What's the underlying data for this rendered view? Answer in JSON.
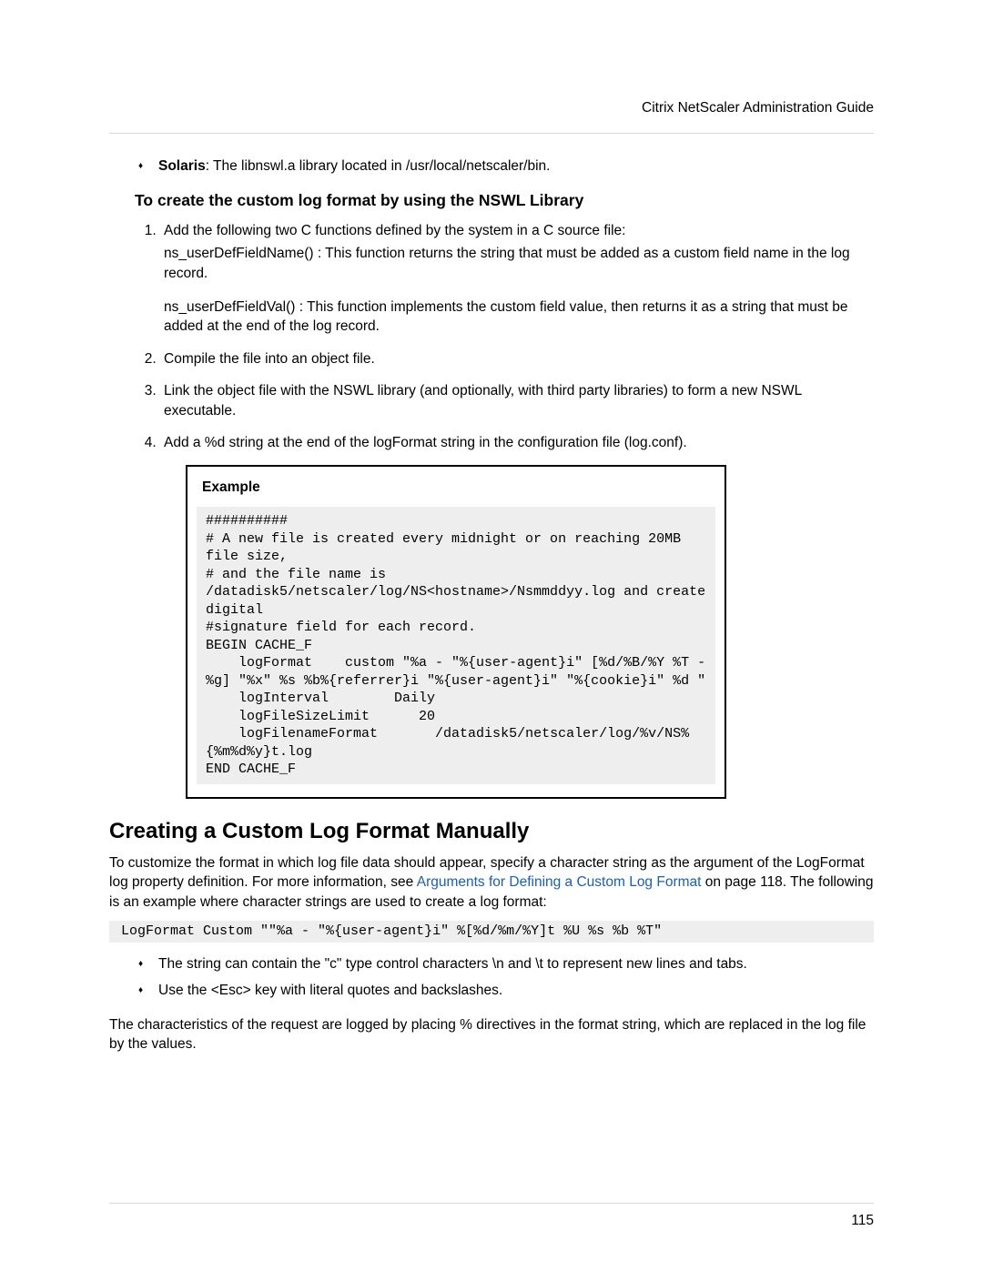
{
  "header": {
    "title": "Citrix NetScaler Administration Guide"
  },
  "solaris": {
    "label": "Solaris",
    "text": ": The libnswl.a library located in /usr/local/netscaler/bin."
  },
  "section1": {
    "heading": "To create the custom log format by using the NSWL Library"
  },
  "steps": {
    "s1a": "Add the following two C functions defined by the system in a C source file:",
    "s1b": "ns_userDefFieldName() : This function returns the string that must be added as a custom field name in the log record.",
    "s1c": "ns_userDefFieldVal() : This function implements the custom field value, then returns it as a string that must be added at the end of the log record.",
    "s2": "Compile the file into an object file.",
    "s3": "Link the object file with the NSWL library (and optionally, with third party libraries) to form a new NSWL executable.",
    "s4": "Add a %d string at the end of the logFormat string in the configuration file (log.conf)."
  },
  "example": {
    "label": "Example",
    "code": "##########\n# A new file is created every midnight or on reaching 20MB file size,\n# and the file name is /datadisk5/netscaler/log/NS<hostname>/Nsmmddyy.log and create digital \n#signature field for each record.\nBEGIN CACHE_F\n    logFormat    custom \"%a - \"%{user-agent}i\" [%d/%B/%Y %T -%g] \"%x\" %s %b%{referrer}i \"%{user-agent}i\" \"%{cookie}i\" %d \"\n    logInterval        Daily\n    logFileSizeLimit      20\n    logFilenameFormat       /datadisk5/netscaler/log/%v/NS%{%m%d%y}t.log\nEND CACHE_F"
  },
  "section2": {
    "heading": "Creating a Custom Log Format Manually",
    "p1a": "To customize the format in which log file data should appear, specify a character string as the argument of the LogFormat log property definition. For more information, see ",
    "link": "Arguments for Defining a Custom Log Format",
    "p1b": " on page 118. The following is an example where character strings are used to create a log format:",
    "code": " LogFormat Custom \"\"%a - \"%{user-agent}i\" %[%d/%m/%Y]t %U %s %b %T\"",
    "b1": "The string can contain the \"c\" type control characters \\n and \\t to represent new lines and tabs.",
    "b2": "Use the <Esc> key with literal quotes and backslashes.",
    "p2": "The characteristics of the request are logged by placing % directives in the format string, which are replaced in the log file by the values."
  },
  "footer": {
    "page": "115"
  }
}
